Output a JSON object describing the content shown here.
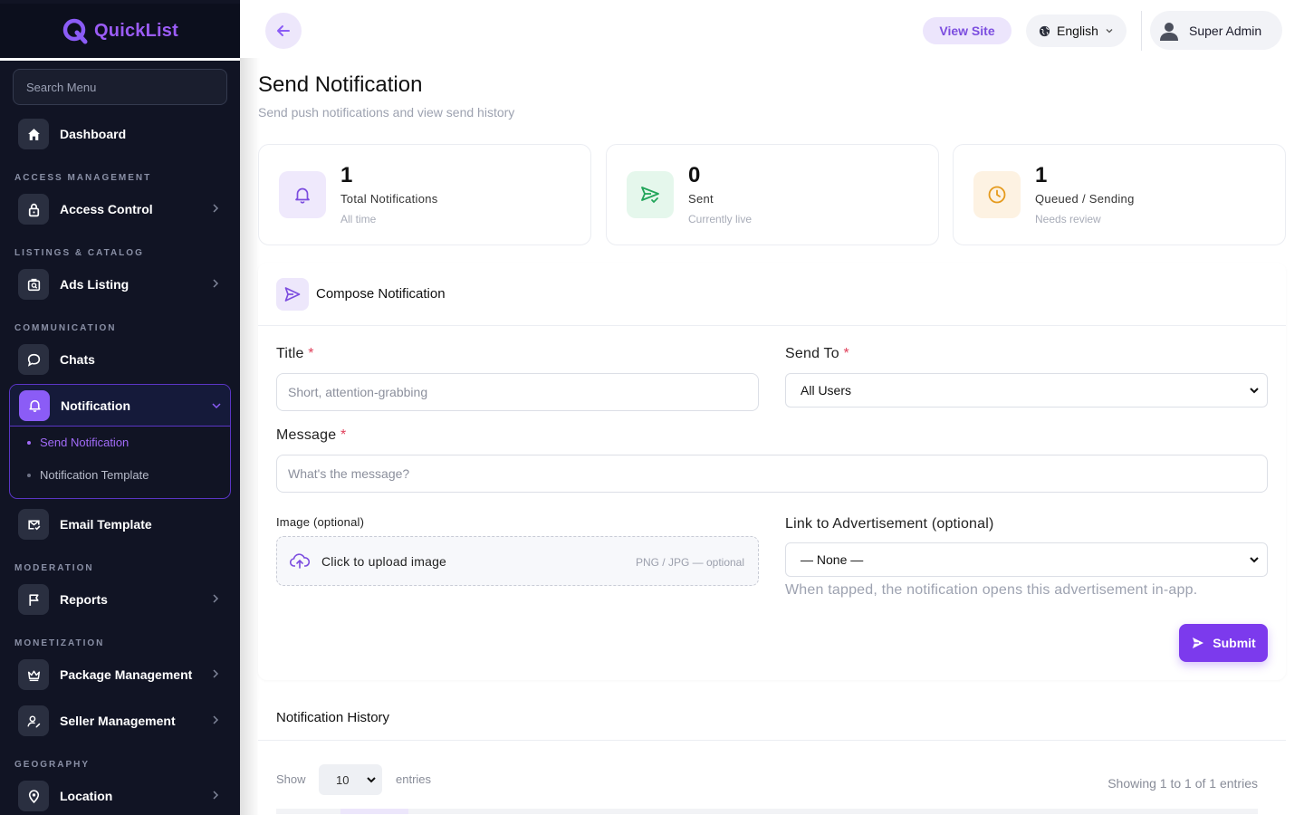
{
  "app": {
    "brand": "QuickList"
  },
  "sidebar": {
    "search_placeholder": "Search Menu",
    "dashboard": "Dashboard",
    "sections": {
      "access": "ACCESS MANAGEMENT",
      "listings": "LISTINGS & CATALOG",
      "communication": "COMMUNICATION",
      "moderation": "MODERATION",
      "monetization": "MONETIZATION",
      "geography": "GEOGRAPHY"
    },
    "items": {
      "access_control": "Access Control",
      "ads_listing": "Ads Listing",
      "chats": "Chats",
      "notification": "Notification",
      "send_notification": "Send Notification",
      "notification_template": "Notification Template",
      "email_template": "Email Template",
      "reports": "Reports",
      "package_management": "Package Management",
      "seller_management": "Seller Management",
      "location": "Location"
    }
  },
  "topbar": {
    "view_site": "View Site",
    "language": "English",
    "user": "Super Admin"
  },
  "page": {
    "title": "Send Notification",
    "subtitle": "Send push notifications and view send history"
  },
  "stats": [
    {
      "value": "1",
      "label": "Total Notifications",
      "note": "All time",
      "color": "#7c4ddf"
    },
    {
      "value": "0",
      "label": "Sent",
      "note": "Currently live",
      "color": "#22a55a"
    },
    {
      "value": "1",
      "label": "Queued / Sending",
      "note": "Needs review",
      "color": "#e59a1c"
    }
  ],
  "compose": {
    "title": "Compose Notification",
    "title_label": "Title",
    "title_placeholder": "Short, attention-grabbing",
    "send_to_label": "Send To",
    "send_to_value": "All Users",
    "message_label": "Message",
    "message_placeholder": "What's the message?",
    "image_label": "Image (optional)",
    "upload_label": "Click to upload image",
    "upload_note": "PNG / JPG — optional",
    "link_label": "Link to Advertisement (optional)",
    "link_value": "— None —",
    "link_hint": "When tapped, the notification opens this advertisement in-app.",
    "required_mark": "*",
    "submit": "Submit"
  },
  "history": {
    "title": "Notification History",
    "show": "Show",
    "entries_value": "10",
    "entries": "entries",
    "showing": "Showing 1 to 1 of 1 entries"
  },
  "colors": {
    "accent": "#7c3aed",
    "sidebar_bg": "#111424"
  }
}
